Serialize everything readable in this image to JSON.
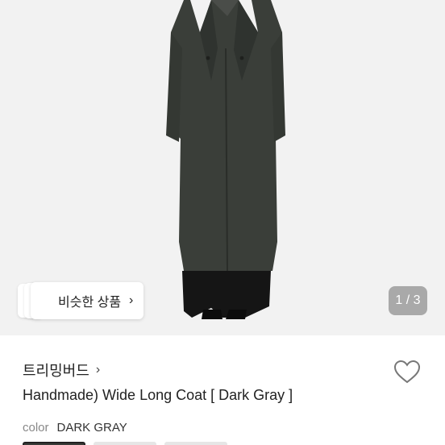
{
  "product_image": {
    "icon": "product-photo-coat",
    "background": "#f2f2f2",
    "coat_color": "#3a3e39"
  },
  "similar_products": {
    "label": "비슷한 상품",
    "chevron": "›"
  },
  "page_indicator": {
    "text": "1 / 3"
  },
  "shop": {
    "name": "트리밍버드",
    "chevron": "›"
  },
  "wishlist": {
    "icon": "heart-outline-icon"
  },
  "product": {
    "title": "Handmade) Wide Long Coat [ Dark Gray ]"
  },
  "color_option": {
    "label": "color",
    "value": "DARK GRAY"
  },
  "swatches": [
    {
      "name": "swatch-dark-gray",
      "selected": true
    },
    {
      "name": "swatch-2",
      "selected": false
    },
    {
      "name": "swatch-3",
      "selected": false
    }
  ]
}
